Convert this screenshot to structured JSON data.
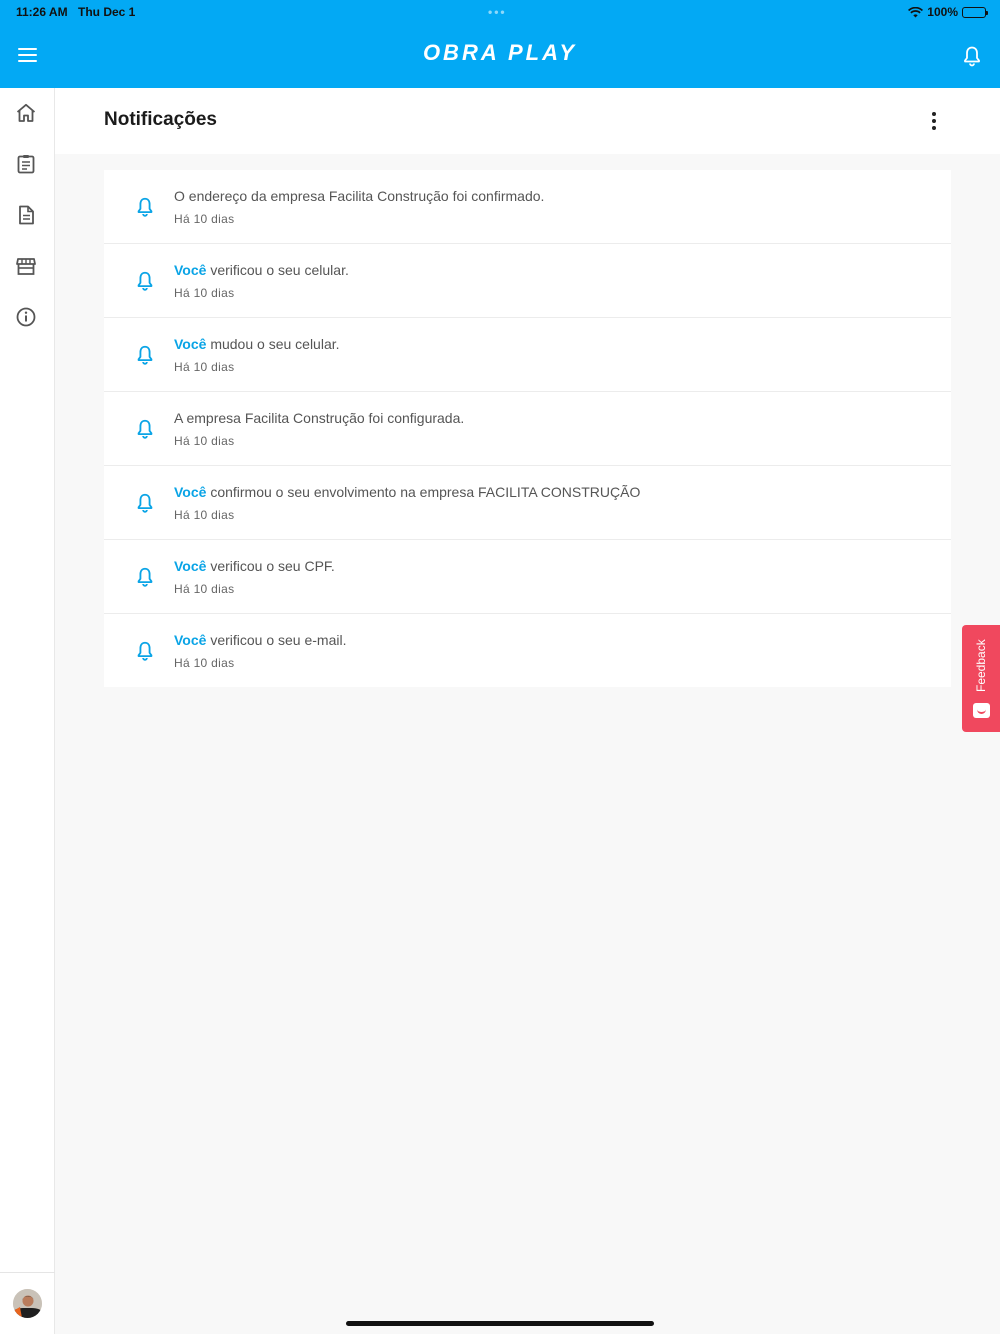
{
  "status_bar": {
    "time": "11:26 AM",
    "date": "Thu Dec 1",
    "battery": "100%"
  },
  "header": {
    "brand": "OBRA PLAY"
  },
  "page": {
    "title": "Notificações"
  },
  "notifications": [
    {
      "highlight": "",
      "text": "O endereço da empresa Facilita Construção foi confirmado.",
      "ago": "Há 10 dias"
    },
    {
      "highlight": "Você",
      "text": " verificou o seu celular.",
      "ago": "Há 10 dias"
    },
    {
      "highlight": "Você",
      "text": " mudou o seu celular.",
      "ago": "Há 10 dias"
    },
    {
      "highlight": "",
      "text": "A empresa Facilita Construção foi configurada.",
      "ago": "Há 10 dias"
    },
    {
      "highlight": "Você",
      "text": " confirmou o seu envolvimento na empresa FACILITA CONSTRUÇÃO",
      "ago": "Há 10 dias"
    },
    {
      "highlight": "Você",
      "text": " verificou o seu CPF.",
      "ago": "Há 10 dias"
    },
    {
      "highlight": "Você",
      "text": " verificou o seu e-mail.",
      "ago": "Há 10 dias"
    }
  ],
  "feedback": {
    "label": "Feedback"
  },
  "colors": {
    "primary": "#03a9f4",
    "highlight": "#0aa4e6",
    "feedback": "#f0485e"
  }
}
